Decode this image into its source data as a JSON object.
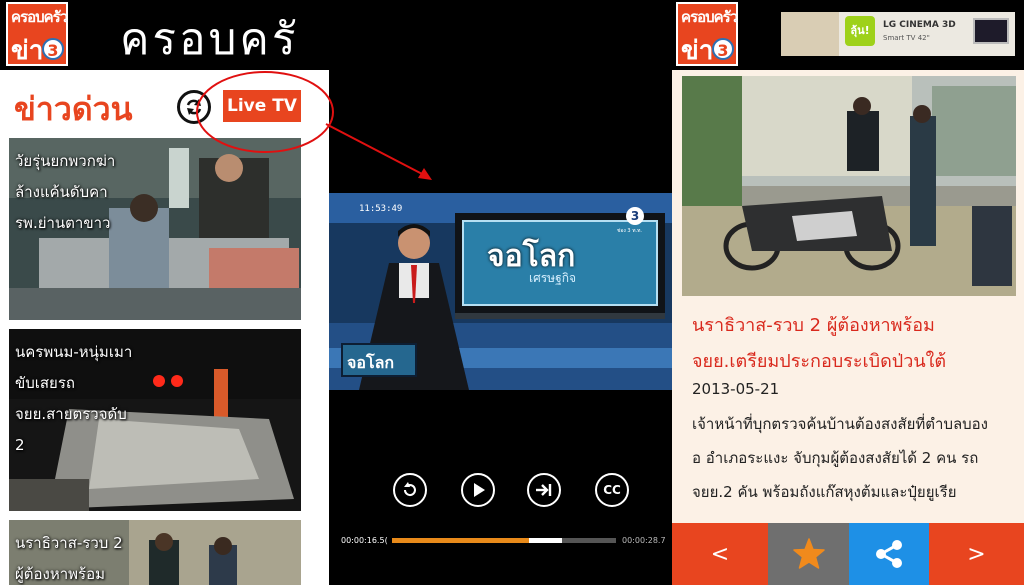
{
  "left_header": {
    "logo_line1": "ครอบครัว",
    "logo_line2": "ข่าว",
    "logo_channel": "3",
    "app_title": "ครอบครั"
  },
  "left_panel": {
    "section_title": "ข่าวด่วน",
    "refresh_icon": "refresh-icon",
    "live_button": "Live TV",
    "news": [
      {
        "title": "วัยรุ่นยกพวกฆ่า ล้างแค้นดับคา รพ.ย่านตาขาว"
      },
      {
        "title": "นครพนม-หนุ่มเมาขับเสยรถ จยย.สายตรวจดับ 2"
      },
      {
        "title": "นราธิวาส-รวบ 2 ผู้ต้องหาพร้อม"
      }
    ]
  },
  "video": {
    "clock": "11:53:49",
    "screen_title": "จอโลก",
    "screen_subtitle": "เศรษฐกิจ",
    "desk_sign": "จอโลก",
    "channel_logo": "3",
    "channel_sub": "ช่อง 3 ท.ท.",
    "time_elapsed": "00:00:16.5(",
    "time_total": "00:00:28.7",
    "progress": 0.61,
    "buffered": 0.76,
    "controls": [
      "replay-icon",
      "play-icon",
      "skip-next-icon",
      "closed-captions-icon"
    ],
    "cc_label": "CC"
  },
  "right_header": {
    "logo_line1": "ครอบครัว",
    "logo_line2": "ข่าว",
    "logo_channel": "3",
    "ad_text": "LG CINEMA 3D",
    "ad_sub": "Smart TV 42\"",
    "ad_badge": "ลุ้น!"
  },
  "article": {
    "title_line1": "นราธิวาส-รวบ 2 ผู้ต้องหาพร้อม",
    "title_line2": "จยย.เตรียมประกอบระเบิดป่วนใต้",
    "date": "2013-05-21",
    "body_line1": "เจ้าหน้าที่บุกตรวจค้นบ้านต้องสงสัยที่ตำบลบอง",
    "body_line2": "อ อำเภอระแงะ จับกุมผู้ต้องสงสัยได้ 2 คน รถ",
    "body_line3": "จยย.2 คัน พร้อมถังแก๊สหุงต้มและปุ๋ยยูเรีย"
  },
  "bottom_bar": {
    "prev": "<",
    "next": ">",
    "favorite_icon": "star-icon",
    "share_icon": "share-icon"
  },
  "colors": {
    "accent": "#e8451f",
    "gray_button": "#6f6f6f",
    "blue_button": "#1e90e6",
    "title_red": "#d9291d",
    "annotation_red": "#e01010",
    "progress_orange": "#e88a1a"
  }
}
